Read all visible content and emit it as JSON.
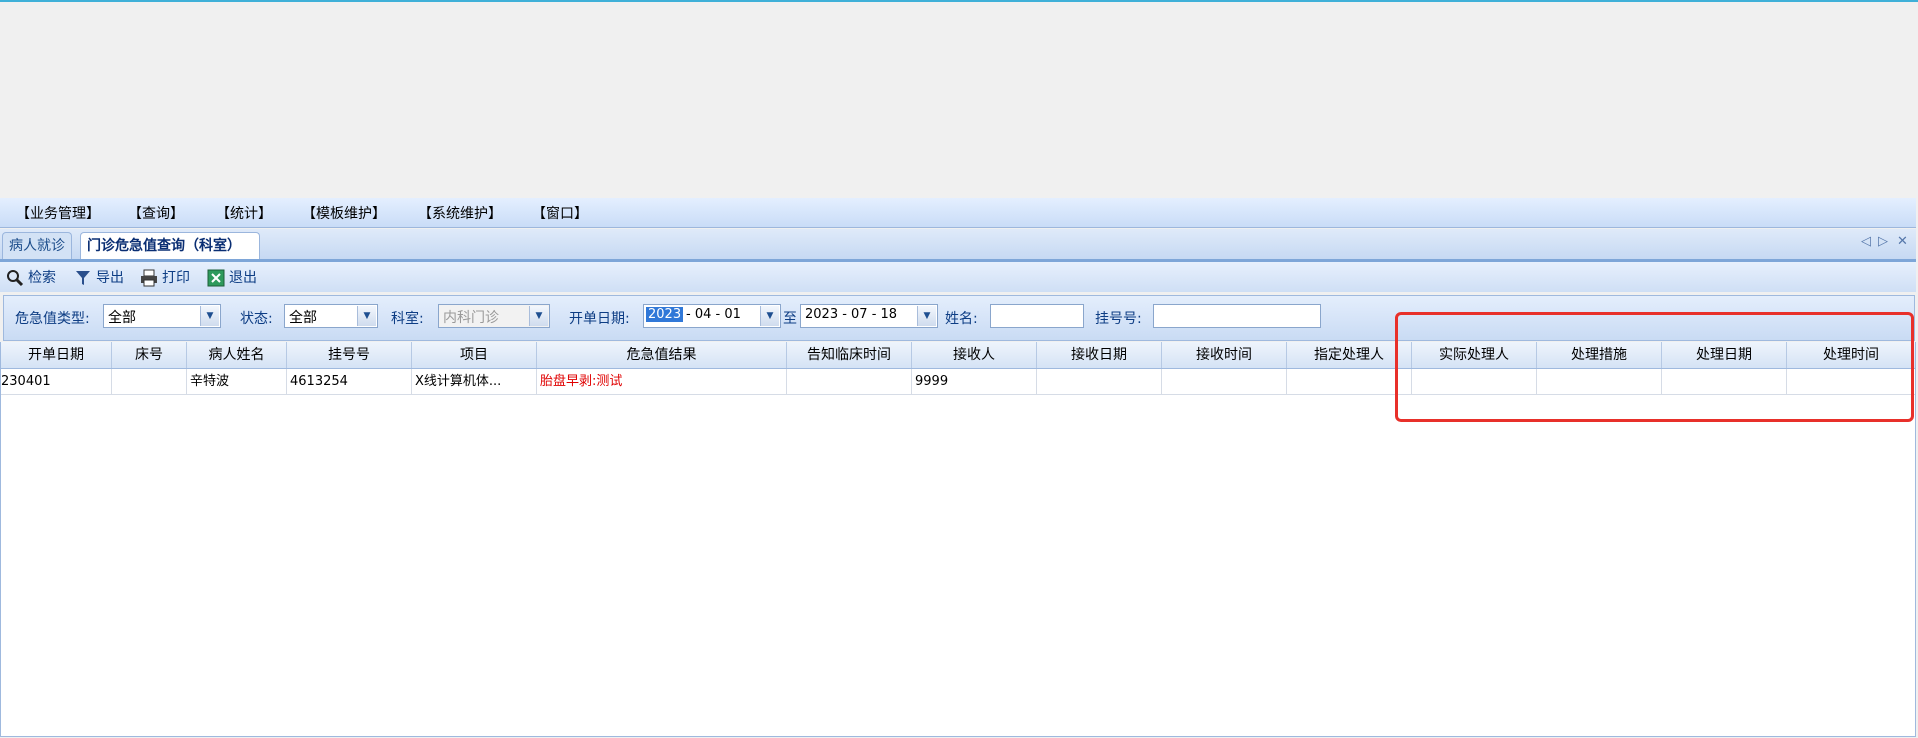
{
  "menu": [
    "【业务管理】",
    "【查询】",
    "【统计】",
    "【模板维护】",
    "【系统维护】",
    "【窗口】"
  ],
  "tabs": {
    "inactive": "病人就诊",
    "active": "门诊危急值查询（科室）"
  },
  "tab_nav": {
    "prev": "◁",
    "next": "▷",
    "close": "✕"
  },
  "toolbar": {
    "search": "检索",
    "export": "导出",
    "print": "打印",
    "exit": "退出"
  },
  "filters": {
    "type_label": "危急值类型:",
    "type_value": "全部",
    "status_label": "状态:",
    "status_value": "全部",
    "dept_label": "科室:",
    "dept_value": "内科门诊",
    "date_label": "开单日期:",
    "date_from_year": "2023",
    "date_from_rest": "- 04 - 01",
    "to_label": "至",
    "date_to": "2023 - 07 - 18",
    "name_label": "姓名:",
    "reg_label": "挂号号:"
  },
  "grid": {
    "columns": [
      "开单日期",
      "床号",
      "病人姓名",
      "挂号号",
      "项目",
      "危急值结果",
      "告知临床时间",
      "接收人",
      "接收日期",
      "接收时间",
      "指定处理人",
      "实际处理人",
      "处理措施",
      "处理日期",
      "处理时间"
    ],
    "rows": [
      [
        "230401",
        "",
        "辛特波",
        "4613254",
        "X线计算机体...",
        "胎盘早剥:测试",
        "",
        "9999",
        "",
        "",
        "",
        "",
        "",
        "",
        ""
      ]
    ]
  },
  "colors": {
    "accent": "#3078d8",
    "highlight": "#e8302a",
    "result": "#e00000"
  }
}
